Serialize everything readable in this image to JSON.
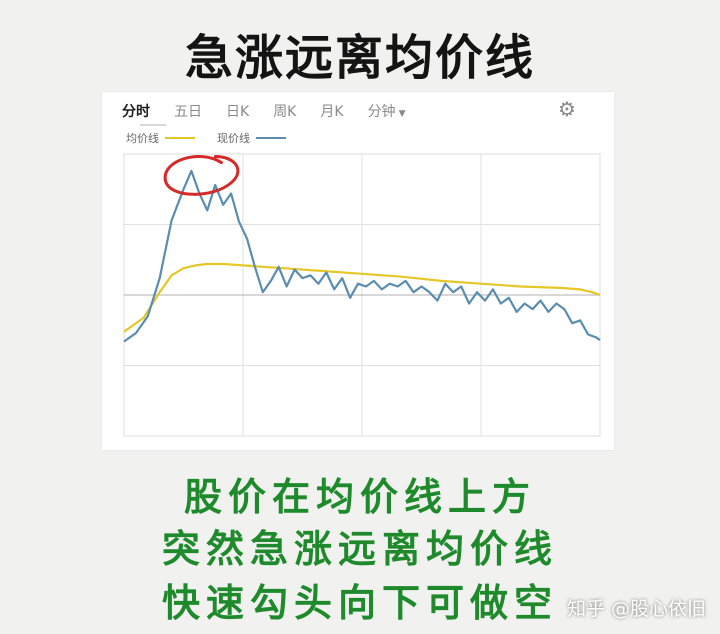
{
  "title": "急涨远离均价线",
  "tabs": [
    {
      "label": "分时",
      "active": true
    },
    {
      "label": "五日"
    },
    {
      "label": "日K"
    },
    {
      "label": "周K"
    },
    {
      "label": "月K"
    },
    {
      "label": "分钟"
    }
  ],
  "legend": {
    "avg_label": "均价线",
    "price_label": "现价线",
    "avg_color": "#e6c728",
    "price_color": "#5b8db0"
  },
  "annotation_color": "#d42a2a",
  "captions": [
    "股价在均价线上方",
    "突然急涨远离均价线",
    "快速勾头向下可做空"
  ],
  "watermark": "知乎 @股心依旧",
  "chart_data": {
    "type": "line",
    "x_range": [
      0,
      240
    ],
    "y_range": [
      -1,
      1
    ],
    "series": [
      {
        "name": "现价线",
        "x": [
          0,
          6,
          12,
          18,
          24,
          30,
          34,
          38,
          42,
          46,
          50,
          54,
          58,
          62,
          66,
          70,
          74,
          78,
          82,
          86,
          90,
          94,
          98,
          102,
          106,
          110,
          114,
          118,
          122,
          126,
          130,
          134,
          138,
          142,
          146,
          150,
          154,
          158,
          162,
          166,
          170,
          174,
          178,
          182,
          186,
          190,
          194,
          198,
          202,
          206,
          210,
          214,
          218,
          222,
          226,
          230,
          234,
          238,
          240
        ],
        "y": [
          -0.33,
          -0.27,
          -0.15,
          0.12,
          0.53,
          0.75,
          0.88,
          0.72,
          0.6,
          0.78,
          0.64,
          0.72,
          0.52,
          0.4,
          0.2,
          0.02,
          0.1,
          0.2,
          0.06,
          0.18,
          0.12,
          0.14,
          0.08,
          0.16,
          0.04,
          0.12,
          -0.02,
          0.08,
          0.06,
          0.1,
          0.04,
          0.08,
          0.06,
          0.1,
          0.02,
          0.06,
          0.02,
          -0.04,
          0.08,
          0.02,
          0.06,
          -0.06,
          0.02,
          -0.04,
          0.04,
          -0.06,
          -0.02,
          -0.12,
          -0.06,
          -0.1,
          -0.04,
          -0.12,
          -0.06,
          -0.1,
          -0.2,
          -0.18,
          -0.28,
          -0.3,
          -0.32
        ]
      },
      {
        "name": "均价线",
        "x": [
          0,
          10,
          18,
          24,
          30,
          36,
          42,
          50,
          60,
          80,
          100,
          120,
          140,
          160,
          180,
          200,
          220,
          230,
          236,
          240
        ],
        "y": [
          -0.26,
          -0.16,
          0.02,
          0.14,
          0.19,
          0.21,
          0.22,
          0.22,
          0.21,
          0.19,
          0.17,
          0.15,
          0.13,
          0.1,
          0.08,
          0.06,
          0.05,
          0.04,
          0.02,
          0.0
        ]
      }
    ],
    "highlight": {
      "x": 36,
      "y": 0.84,
      "label": ""
    }
  }
}
